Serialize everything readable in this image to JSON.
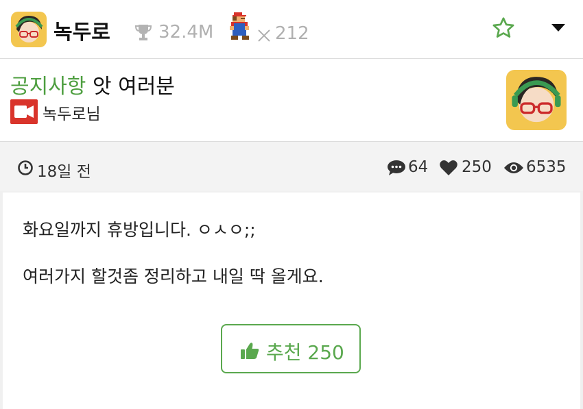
{
  "header": {
    "channel_name": "녹두로",
    "followers": "32.4M",
    "level": "212",
    "icons": [
      "avatar",
      "trophy-icon",
      "mario-badge-icon",
      "times-icon",
      "star-icon",
      "dropdown-caret-icon"
    ]
  },
  "post": {
    "category": "공지사항",
    "title": "앗 여러분",
    "author": "녹두로님",
    "time_ago": "18일 전",
    "comments": "64",
    "likes": "250",
    "views": "6535",
    "body_lines": [
      "화요일까지 휴방입니다. ㅇㅅㅇ;;",
      "여러가지 할것좀 정리하고 내일 딱 올게요."
    ],
    "recommend_label": "추천 250"
  },
  "colors": {
    "accent_green": "#5aa84e",
    "category_green": "#4d9e3f",
    "muted_gray": "#b0b0b0",
    "video_red": "#d9342b"
  }
}
